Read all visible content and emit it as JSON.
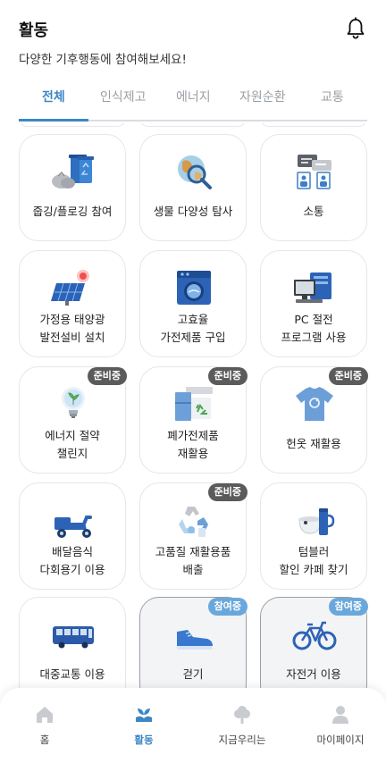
{
  "header": {
    "title": "활동",
    "subtitle": "다양한 기후행동에 참여해보세요!",
    "bell_icon": "bell-icon"
  },
  "tabs": [
    {
      "label": "전체",
      "active": true
    },
    {
      "label": "인식제고",
      "active": false
    },
    {
      "label": "에너지",
      "active": false
    },
    {
      "label": "자원순환",
      "active": false
    },
    {
      "label": "교통",
      "active": false
    }
  ],
  "colors": {
    "accent": "#3d86c6",
    "badge_preparing": "#5b5b5b",
    "badge_joined": "#6aa8dc"
  },
  "activities": [
    {
      "lines": [
        "줍깅/플로깅 참여"
      ],
      "icon": "trash-bins-icon",
      "badge": ""
    },
    {
      "lines": [
        "생물 다양성 탐사"
      ],
      "icon": "globe-magnifier-icon",
      "badge": ""
    },
    {
      "lines": [
        "소통"
      ],
      "icon": "communication-board-icon",
      "badge": ""
    },
    {
      "lines": [
        "가정용 태양광",
        "발전설비 설치"
      ],
      "icon": "solar-panel-icon",
      "badge": ""
    },
    {
      "lines": [
        "고효율",
        "가전제품 구입"
      ],
      "icon": "washing-machine-icon",
      "badge": ""
    },
    {
      "lines": [
        "PC 절전",
        "프로그램 사용"
      ],
      "icon": "computer-icon",
      "badge": ""
    },
    {
      "lines": [
        "에너지 절약",
        "챌린지"
      ],
      "icon": "lightbulb-icon",
      "badge": "준비중"
    },
    {
      "lines": [
        "폐가전제품",
        "재활용"
      ],
      "icon": "appliance-recycle-icon",
      "badge": "준비중"
    },
    {
      "lines": [
        "헌옷 재활용"
      ],
      "icon": "tshirt-recycle-icon",
      "badge": "준비중"
    },
    {
      "lines": [
        "배달음식",
        "다회용기 이용"
      ],
      "icon": "delivery-scooter-icon",
      "badge": ""
    },
    {
      "lines": [
        "고품질 재활용품",
        "배출"
      ],
      "icon": "recycle-arrows-icon",
      "badge": "준비중"
    },
    {
      "lines": [
        "텀블러",
        "할인 카페 찾기"
      ],
      "icon": "tumbler-icon",
      "badge": ""
    },
    {
      "lines": [
        "대중교통 이용"
      ],
      "icon": "bus-icon",
      "badge": ""
    },
    {
      "lines": [
        "걷기"
      ],
      "icon": "shoe-icon",
      "badge": "참여중"
    },
    {
      "lines": [
        "자전거 이용"
      ],
      "icon": "bicycle-icon",
      "badge": "참여중"
    }
  ],
  "bottom_nav": [
    {
      "label": "홈",
      "icon": "home-icon",
      "active": false
    },
    {
      "label": "활동",
      "icon": "sprout-hand-icon",
      "active": true
    },
    {
      "label": "지금우리는",
      "icon": "tree-icon",
      "active": false
    },
    {
      "label": "마이페이지",
      "icon": "person-icon",
      "active": false
    }
  ]
}
